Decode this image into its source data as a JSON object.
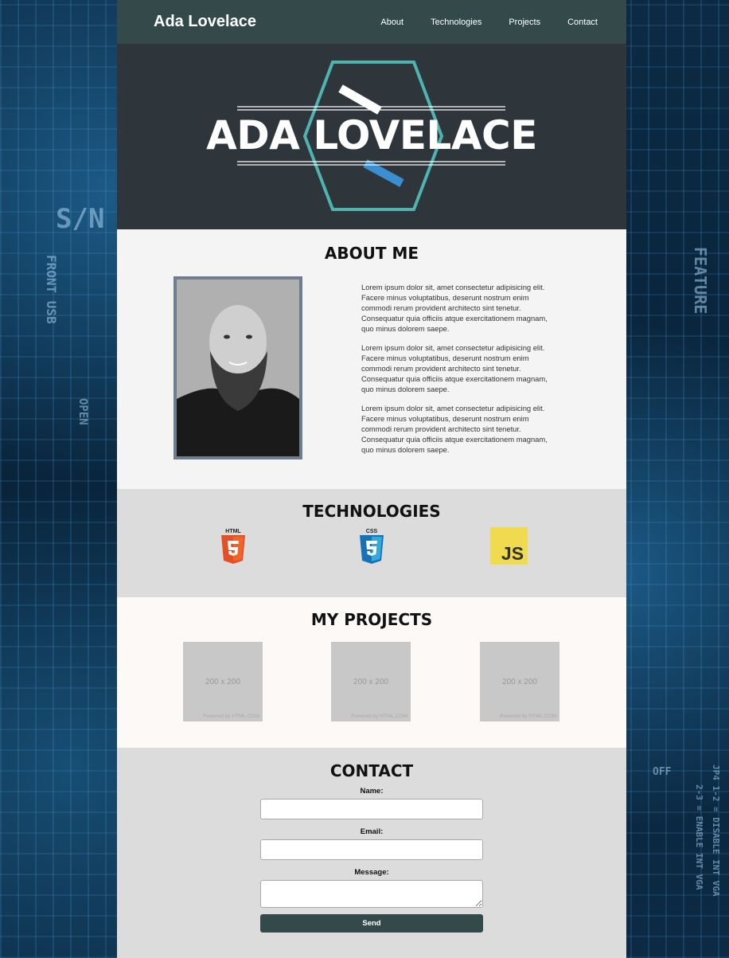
{
  "nav": {
    "brand": "Ada Lovelace",
    "links": [
      "About",
      "Technologies",
      "Projects",
      "Contact"
    ]
  },
  "hero": {
    "title": "ADA LOVELACE"
  },
  "about": {
    "heading": "ABOUT ME",
    "paragraphs": [
      "Lorem ipsum dolor sit, amet consectetur adipisicing elit. Facere minus voluptatibus, deserunt nostrum enim commodi rerum provident architecto sint tenetur. Consequatur quia officiis atque exercitationem magnam, quo minus dolorem saepe.",
      "Lorem ipsum dolor sit, amet consectetur adipisicing elit. Facere minus voluptatibus, deserunt nostrum enim commodi rerum provident architecto sint tenetur. Consequatur quia officiis atque exercitationem magnam, quo minus dolorem saepe.",
      "Lorem ipsum dolor sit, amet consectetur adipisicing elit. Facere minus voluptatibus, deserunt nostrum enim commodi rerum provident architecto sint tenetur. Consequatur quia officiis atque exercitationem magnam, quo minus dolorem saepe."
    ]
  },
  "tech": {
    "heading": "TECHNOLOGIES",
    "html_label": "HTML",
    "css_label": "CSS",
    "js_label": "JS"
  },
  "projects": {
    "heading": "MY PROJECTS",
    "thumb_label": "200 x 200",
    "thumb_powered": [
      "Powered by HTML.COM",
      "Powered by HTML.COM",
      "Powered by HTML.COM"
    ]
  },
  "contact": {
    "heading": "CONTACT",
    "name_label": "Name:",
    "email_label": "Email:",
    "message_label": "Message:",
    "send_label": "Send"
  },
  "background_text": {
    "sn": "S/N",
    "front_usb": "FRONT USB",
    "feature": "FEATURE",
    "off": "OFF",
    "open": "OPEN",
    "jumper_left": "JP4 1-2 = DISABLE INT VGA",
    "jumper_right": "2-3 = ENABLE INT VGA"
  },
  "colors": {
    "navbar": "#344a4a",
    "hero": "#2e353b",
    "hexagon": "#4fb3b0",
    "accent_blue": "#3a8fd0"
  }
}
